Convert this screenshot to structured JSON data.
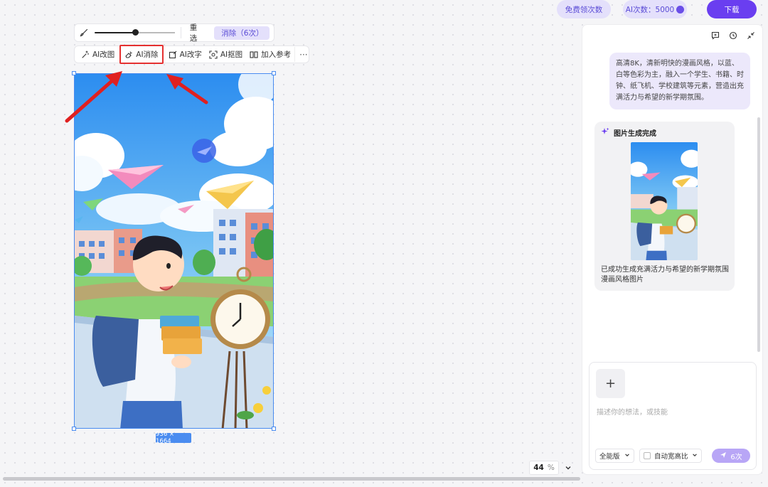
{
  "topbar": {
    "free_label": "免费领次数",
    "credits_label": "AI次数：5000",
    "download_label": "下载"
  },
  "brush_toolbar": {
    "brush_size_fraction": 0.5,
    "reset_label": "重选",
    "erase_label": "消除（6次）"
  },
  "ai_toolbar": {
    "tools": [
      {
        "label": "AI改图",
        "icon": "magic-edit-icon"
      },
      {
        "label": "AI消除",
        "icon": "eraser-icon"
      },
      {
        "label": "AI改字",
        "icon": "edit-text-icon"
      },
      {
        "label": "AI抠图",
        "icon": "cutout-icon"
      },
      {
        "label": "加入参考",
        "icon": "reference-icon"
      }
    ],
    "more_label": "···"
  },
  "canvas": {
    "dimensions_label": "936 × 1664"
  },
  "zoom": {
    "value": "44",
    "unit": "%"
  },
  "chat": {
    "user_prompt": "高清8K，清新明快的漫画风格，以蓝、白等色彩为主，融入一个学生、书籍、时钟、纸飞机、学校建筑等元素，营造出充满活力与希望的新学期氛围。",
    "result_title": "图片生成完成",
    "result_desc": "已成功生成充满活力与希望的新学期氛围漫画风格图片"
  },
  "composer": {
    "placeholder": "描述你的想法，或技能",
    "mode_label": "全能版",
    "ratio_label": "自动宽高比",
    "send_label": "6次"
  },
  "colors": {
    "accent": "#6a3ef0",
    "highlight_box": "#e53030",
    "selection": "#4a8cf0"
  }
}
